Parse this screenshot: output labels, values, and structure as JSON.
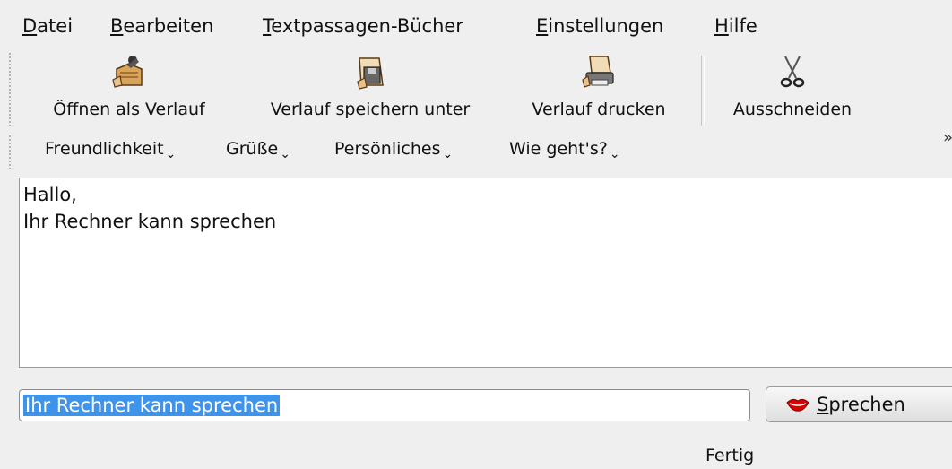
{
  "menubar": {
    "items": [
      {
        "mnemonic": "D",
        "rest": "atei"
      },
      {
        "mnemonic": "B",
        "rest": "earbeiten"
      },
      {
        "mnemonic": "T",
        "rest": "extpassagen-Bücher"
      },
      {
        "mnemonic": "E",
        "rest": "instellungen"
      },
      {
        "mnemonic": "H",
        "rest": "ilfe"
      }
    ]
  },
  "toolbar": {
    "buttons": [
      {
        "label": "Öffnen als Verlauf",
        "icon": "open-history-icon"
      },
      {
        "label": "Verlauf speichern unter",
        "icon": "save-history-icon"
      },
      {
        "label": "Verlauf drucken",
        "icon": "print-history-icon"
      },
      {
        "label": "Ausschneiden",
        "icon": "scissors-icon"
      }
    ],
    "overflow": "»"
  },
  "phrasebooks": {
    "items": [
      "Freundlichkeit",
      "Grüße",
      "Persönliches",
      "Wie geht's?"
    ],
    "arrow": "⌄"
  },
  "history": {
    "lines": [
      "Hallo,",
      "Ihr Rechner kann sprechen"
    ]
  },
  "input": {
    "value": "Ihr Rechner kann sprechen"
  },
  "speak_button": {
    "mnemonic": "S",
    "rest": "prechen",
    "icon": "lips-icon"
  },
  "status": "Fertig",
  "colors": {
    "selection": "#3f94ea",
    "background": "#efefef"
  }
}
